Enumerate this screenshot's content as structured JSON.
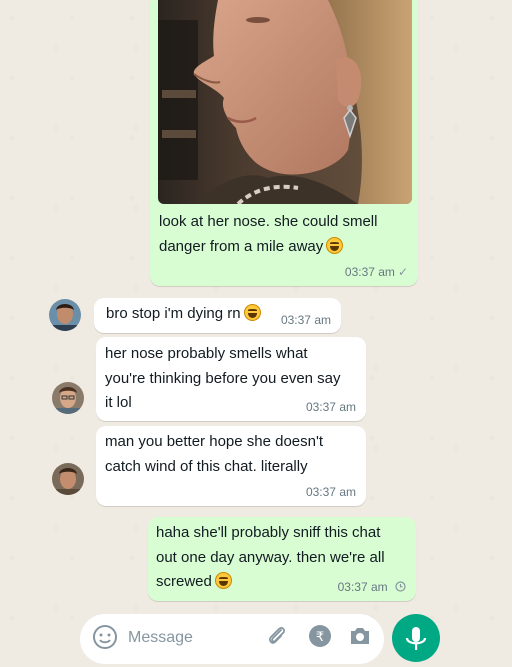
{
  "colors": {
    "chat_background": "#efeae2",
    "outgoing_bubble": "#d9fdd3",
    "incoming_bubble": "#ffffff",
    "accent": "#00a884",
    "timestamp": "#667781"
  },
  "messages": [
    {
      "direction": "outgoing",
      "has_image": true,
      "image_icon": "woman-profile-photo",
      "lines": [
        "look at her nose. she could smell",
        "danger from a mile away"
      ],
      "emoji": "laughing-face-icon",
      "time": "03:37 am",
      "status_icon": "single-check-icon"
    },
    {
      "direction": "incoming",
      "avatar_icon": "contact-avatar-1",
      "lines": [
        "bro stop i'm dying rn"
      ],
      "emoji": "laughing-face-icon",
      "time": "03:37 am"
    },
    {
      "direction": "incoming",
      "avatar_icon": "contact-avatar-2",
      "lines": [
        "her nose probably smells what",
        "you're thinking before you even say",
        "it lol"
      ],
      "time": "03:37 am"
    },
    {
      "direction": "incoming",
      "avatar_icon": "contact-avatar-3",
      "lines": [
        "man you better hope she doesn't",
        "catch wind of this chat. literally"
      ],
      "time": "03:37 am"
    },
    {
      "direction": "outgoing",
      "lines": [
        "haha she'll probably sniff this chat",
        "out one day anyway. then we're all",
        "screwed"
      ],
      "emoji": "laughing-face-icon",
      "time": "03:37 am",
      "status_icon": "clock-pending-icon"
    }
  ],
  "composer": {
    "placeholder": "Message",
    "icons": [
      "emoji-icon",
      "attach-icon",
      "rupee-payment-icon",
      "camera-icon"
    ],
    "send_icon": "microphone-icon"
  }
}
